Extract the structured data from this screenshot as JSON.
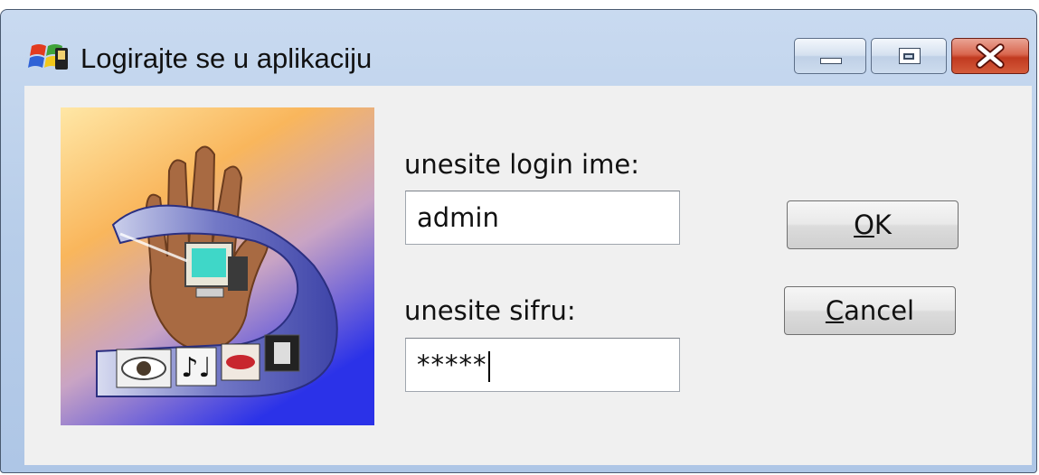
{
  "window": {
    "title": "Logirajte se u aplikaciju",
    "icon": "windows-flag-icon",
    "controls": {
      "minimize": "minimize-icon",
      "maximize": "maximize-icon",
      "close": "close-icon"
    },
    "colors": {
      "titlebar": "#b7cde9",
      "close": "#c13a20",
      "client": "#f0f0f0"
    }
  },
  "form": {
    "login_label": "unesite login ime:",
    "login_value": "admin",
    "password_label": "unesite sifru:",
    "password_value": "*****"
  },
  "buttons": {
    "ok": {
      "mnemonic": "O",
      "rest": "K"
    },
    "cancel": {
      "mnemonic": "C",
      "rest": "ancel"
    }
  },
  "picture": {
    "icon": "multimedia-hand-illustration"
  }
}
